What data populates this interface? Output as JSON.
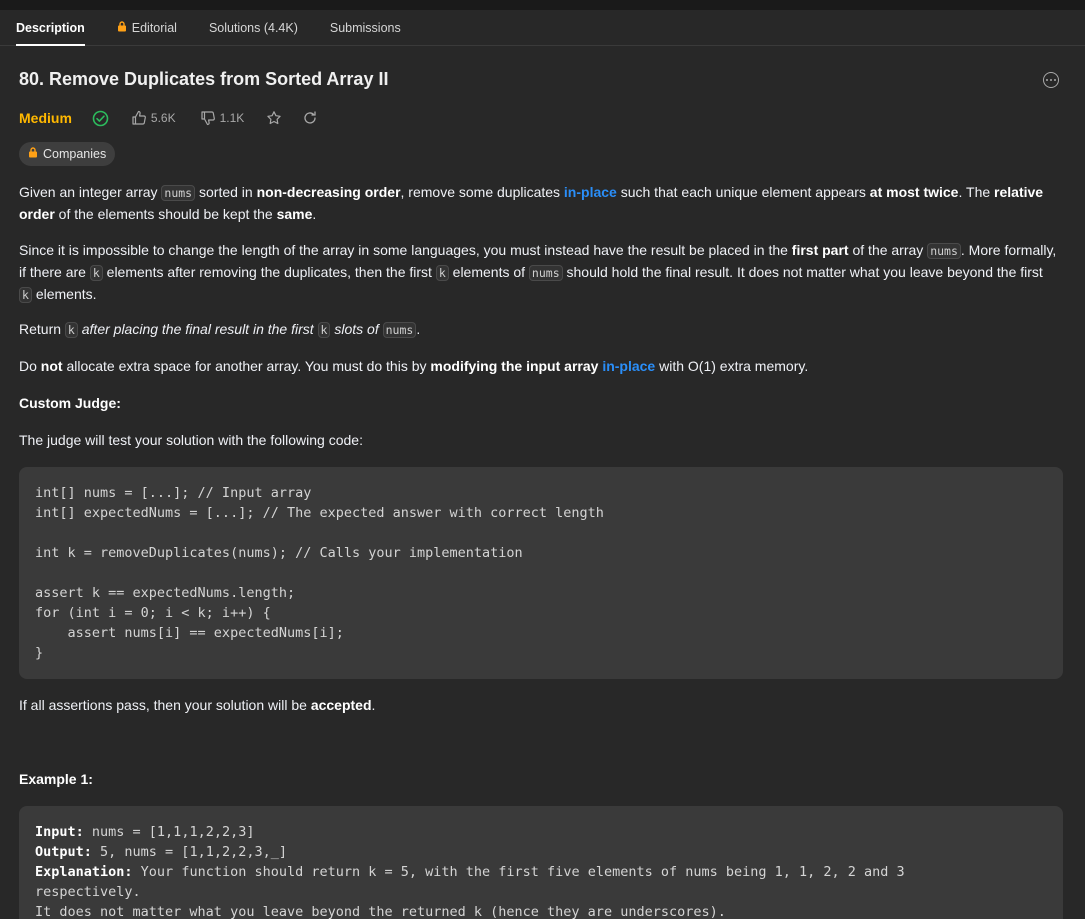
{
  "tabs": [
    {
      "label": "Description"
    },
    {
      "label": "Editorial"
    },
    {
      "label": "Solutions (4.4K)"
    },
    {
      "label": "Submissions"
    }
  ],
  "problem": {
    "title": "80. Remove Duplicates from Sorted Array II",
    "difficulty": "Medium",
    "likes": "5.6K",
    "dislikes": "1.1K",
    "companies_label": "Companies"
  },
  "description": {
    "p1": {
      "t1": "Given an integer array ",
      "c1": "nums",
      "t2": " sorted in ",
      "b1": "non-decreasing order",
      "t3": ", remove some duplicates ",
      "l1": "in-place",
      "t4": " such that each unique element appears ",
      "b2": "at most twice",
      "t5": ". The ",
      "b3": "relative order",
      "t6": " of the elements should be kept the ",
      "b4": "same",
      "t7": "."
    },
    "p2": {
      "t1": "Since it is impossible to change the length of the array in some languages, you must instead have the result be placed in the ",
      "b1": "first part",
      "t2": " of the array ",
      "c1": "nums",
      "t3": ". More formally, if there are ",
      "c2": "k",
      "t4": " elements after removing the duplicates, then the first ",
      "c3": "k",
      "t5": " elements of ",
      "c4": "nums",
      "t6": " should hold the final result. It does not matter what you leave beyond the first ",
      "c5": "k",
      "t7": " elements."
    },
    "p3": {
      "t1": "Return ",
      "c1": "k",
      "i1": " after placing the final result in the first ",
      "c2": "k",
      "i2": " slots of ",
      "c3": "nums",
      "t2": "."
    },
    "p4": {
      "t1": "Do ",
      "b1": "not",
      "t2": " allocate extra space for another array. You must do this by ",
      "b2": "modifying the input array ",
      "l1": "in-place",
      "t3": " with O(1) extra memory."
    },
    "custom_judge_heading": "Custom Judge:",
    "judge_intro": "The judge will test your solution with the following code:",
    "judge_code": [
      "int[] nums = [...]; // Input array",
      "int[] expectedNums = [...]; // The expected answer with correct length",
      "",
      "int k = removeDuplicates(nums); // Calls your implementation",
      "",
      "assert k == expectedNums.length;",
      "for (int i = 0; i < k; i++) {",
      "    assert nums[i] == expectedNums[i];",
      "}"
    ],
    "p5": {
      "t1": "If all assertions pass, then your solution will be ",
      "b1": "accepted",
      "t2": "."
    },
    "example_heading": "Example 1:",
    "example": {
      "input_label": "Input:",
      "input_value": " nums = [1,1,1,2,2,3]",
      "output_label": "Output:",
      "output_value": " 5, nums = [1,1,2,2,3,_]",
      "explanation_label": "Explanation:",
      "explanation_value": " Your function should return k = 5, with the first five elements of nums being 1, 1, 2, 2 and 3",
      "explanation_cont": "respectively.",
      "explanation_cont2": "It does not matter what you leave beyond the returned k (hence they are underscores)."
    }
  }
}
